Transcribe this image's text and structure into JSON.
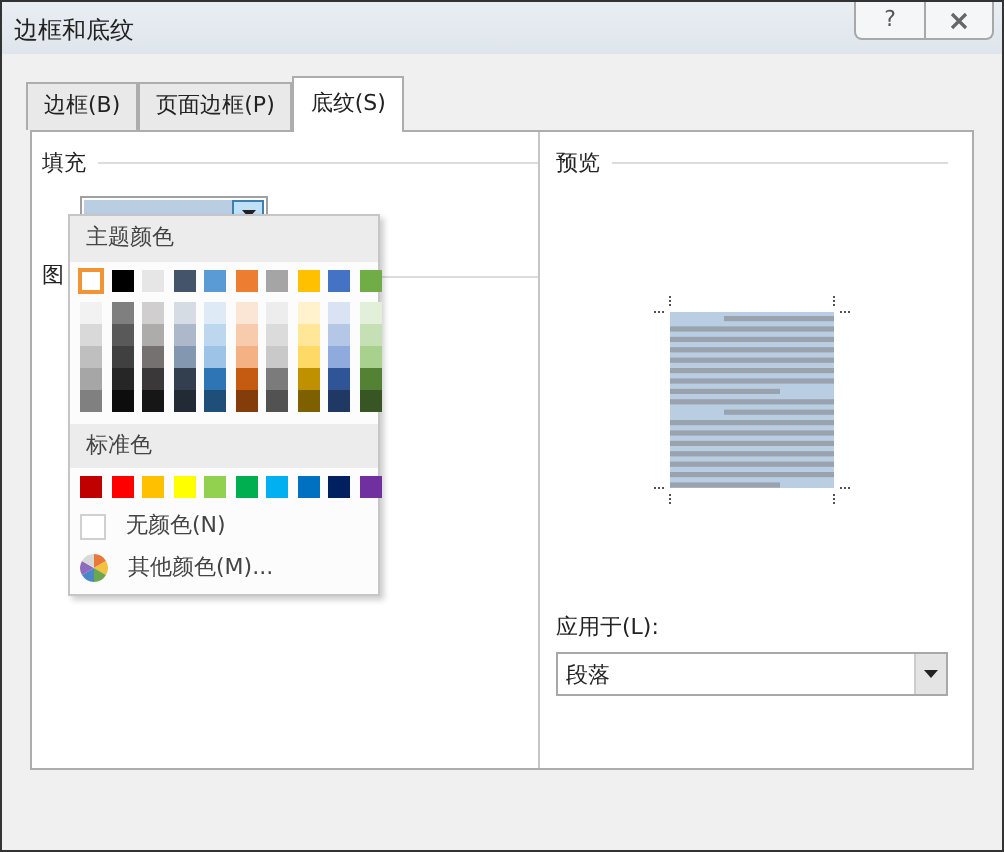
{
  "window": {
    "title": "边框和底纹",
    "help_button": "?"
  },
  "tabs": [
    {
      "label": "边框(B)",
      "selected": false
    },
    {
      "label": "页面边框(P)",
      "selected": false
    },
    {
      "label": "底纹(S)",
      "selected": true
    }
  ],
  "fill": {
    "label": "填充",
    "color": "#b9cde3"
  },
  "pattern": {
    "label": "图"
  },
  "color_menu": {
    "theme_heading": "主题颜色",
    "theme_colors": [
      {
        "color": "#ffffff",
        "selected": true,
        "shades": [
          {
            "color": "#f2f2f2",
            "selected": false
          },
          {
            "color": "#d9d9d9",
            "selected": false
          },
          {
            "color": "#bfbfbf",
            "selected": false
          },
          {
            "color": "#a6a6a6",
            "selected": false
          },
          {
            "color": "#808080",
            "selected": false
          }
        ]
      },
      {
        "color": "#000000",
        "selected": false,
        "shades": [
          {
            "color": "#7f7f7f",
            "selected": false
          },
          {
            "color": "#595959",
            "selected": false
          },
          {
            "color": "#404040",
            "selected": false
          },
          {
            "color": "#262626",
            "selected": false
          },
          {
            "color": "#0d0d0d",
            "selected": false
          }
        ]
      },
      {
        "color": "#e7e6e6",
        "selected": false,
        "shades": [
          {
            "color": "#d0cece",
            "selected": false
          },
          {
            "color": "#aeabab",
            "selected": false
          },
          {
            "color": "#757171",
            "selected": false
          },
          {
            "color": "#3a3838",
            "selected": false
          },
          {
            "color": "#161616",
            "selected": false
          }
        ]
      },
      {
        "color": "#44546a",
        "selected": false,
        "shades": [
          {
            "color": "#d6dce4",
            "selected": false
          },
          {
            "color": "#adb9ca",
            "selected": false
          },
          {
            "color": "#8497b0",
            "selected": false
          },
          {
            "color": "#333f4f",
            "selected": false
          },
          {
            "color": "#222a35",
            "selected": false
          }
        ]
      },
      {
        "color": "#5b9bd5",
        "selected": false,
        "shades": [
          {
            "color": "#deebf6",
            "selected": false
          },
          {
            "color": "#bdd7ee",
            "selected": false
          },
          {
            "color": "#9dc3e6",
            "selected": false
          },
          {
            "color": "#2e75b5",
            "selected": false
          },
          {
            "color": "#1f4e79",
            "selected": false
          }
        ]
      },
      {
        "color": "#ed7d31",
        "selected": false,
        "shades": [
          {
            "color": "#fbe5d5",
            "selected": false
          },
          {
            "color": "#f8cbad",
            "selected": false
          },
          {
            "color": "#f4b183",
            "selected": false
          },
          {
            "color": "#c55a11",
            "selected": false
          },
          {
            "color": "#843c0b",
            "selected": false
          }
        ]
      },
      {
        "color": "#a5a5a5",
        "selected": false,
        "shades": [
          {
            "color": "#ededed",
            "selected": false
          },
          {
            "color": "#dbdbdb",
            "selected": false
          },
          {
            "color": "#c9c9c9",
            "selected": false
          },
          {
            "color": "#7b7b7b",
            "selected": false
          },
          {
            "color": "#525252",
            "selected": false
          }
        ]
      },
      {
        "color": "#ffc000",
        "selected": false,
        "shades": [
          {
            "color": "#fff2cc",
            "selected": false
          },
          {
            "color": "#ffe699",
            "selected": false
          },
          {
            "color": "#ffd966",
            "selected": false
          },
          {
            "color": "#bf9000",
            "selected": false
          },
          {
            "color": "#7f6000",
            "selected": false
          }
        ]
      },
      {
        "color": "#4472c4",
        "selected": false,
        "shades": [
          {
            "color": "#dae3f3",
            "selected": false
          },
          {
            "color": "#b4c7e7",
            "selected": false
          },
          {
            "color": "#8faadc",
            "selected": false
          },
          {
            "color": "#2f5597",
            "selected": false
          },
          {
            "color": "#203864",
            "selected": false
          }
        ]
      },
      {
        "color": "#70ad47",
        "selected": false,
        "shades": [
          {
            "color": "#e2f0d9",
            "selected": false
          },
          {
            "color": "#c5e0b4",
            "selected": false
          },
          {
            "color": "#a9d18e",
            "selected": false
          },
          {
            "color": "#548235",
            "selected": false
          },
          {
            "color": "#375623",
            "selected": false
          }
        ]
      }
    ],
    "standard_heading": "标准色",
    "standard_colors": [
      {
        "color": "#c00000",
        "selected": false
      },
      {
        "color": "#ff0000",
        "selected": false
      },
      {
        "color": "#ffc000",
        "selected": false
      },
      {
        "color": "#ffff00",
        "selected": false
      },
      {
        "color": "#92d050",
        "selected": false
      },
      {
        "color": "#00b050",
        "selected": false
      },
      {
        "color": "#00b0f0",
        "selected": false
      },
      {
        "color": "#0070c0",
        "selected": false
      },
      {
        "color": "#002060",
        "selected": false
      },
      {
        "color": "#7030a0",
        "selected": false
      }
    ],
    "no_color": "无颜色(N)",
    "more_colors": "其他颜色(M)..."
  },
  "preview": {
    "label": "预览"
  },
  "apply_to": {
    "label": "应用于(L):",
    "value": "段落"
  }
}
